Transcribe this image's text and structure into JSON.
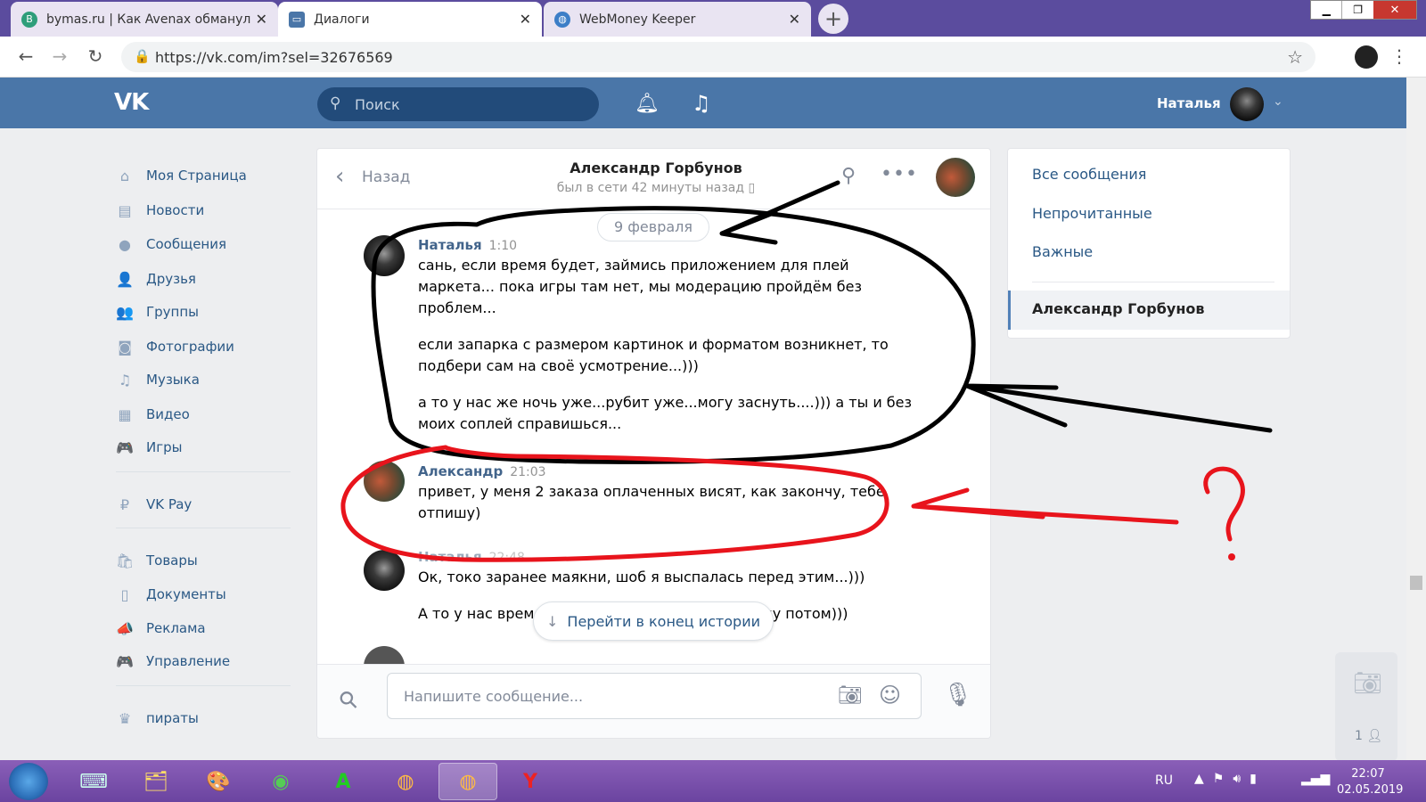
{
  "browser": {
    "tabs": [
      {
        "title": "bymas.ru | Как Avenax обманул",
        "icon_letter": "B"
      },
      {
        "title": "Диалоги",
        "active": true
      },
      {
        "title": "WebMoney Keeper"
      }
    ],
    "url": "https://vk.com/im?sel=32676569"
  },
  "header": {
    "search_placeholder": "Поиск",
    "user_name": "Наталья"
  },
  "sidebar": {
    "items": [
      {
        "label": "Моя Страница",
        "icon": "home-icon",
        "glyph": "⌂"
      },
      {
        "label": "Новости",
        "icon": "news-icon",
        "glyph": "▤"
      },
      {
        "label": "Сообщения",
        "icon": "messages-icon",
        "glyph": "●"
      },
      {
        "label": "Друзья",
        "icon": "friends-icon",
        "glyph": "👤"
      },
      {
        "label": "Группы",
        "icon": "groups-icon",
        "glyph": "👥"
      },
      {
        "label": "Фотографии",
        "icon": "photos-icon",
        "glyph": "◙"
      },
      {
        "label": "Музыка",
        "icon": "music-icon",
        "glyph": "♫"
      },
      {
        "label": "Видео",
        "icon": "video-icon",
        "glyph": "▦"
      },
      {
        "label": "Игры",
        "icon": "games-icon",
        "glyph": "🎮"
      }
    ],
    "items2": [
      {
        "label": "VK Pay",
        "icon": "vkpay-icon",
        "glyph": "₽"
      }
    ],
    "items3": [
      {
        "label": "Товары",
        "icon": "goods-icon",
        "glyph": "🛍"
      },
      {
        "label": "Документы",
        "icon": "docs-icon",
        "glyph": "▯"
      },
      {
        "label": "Реклама",
        "icon": "ads-icon",
        "glyph": "📣"
      },
      {
        "label": "Управление",
        "icon": "manage-icon",
        "glyph": "🎮"
      }
    ],
    "items4": [
      {
        "label": "пираты",
        "icon": "crown-icon",
        "glyph": "♛"
      }
    ]
  },
  "chat": {
    "back_label": "Назад",
    "contact_name": "Александр Горбунов",
    "contact_status": "был в сети 42 минуты назад",
    "date_sticky": "9 февраля",
    "messages": [
      {
        "author": "Наталья",
        "time": "1:10",
        "paragraphs": [
          "сань, если время будет, займись приложением для плей маркета... пока игры там нет, мы модерацию пройдём без проблем...",
          "если запарка с размером картинок и форматом возникнет, то подбери сам на своё усмотрение...)))",
          "а то у нас же ночь уже...рубит уже...могу заснуть....))) а ты и без моих соплей справишься..."
        ]
      },
      {
        "author": "Александр",
        "time": "21:03",
        "paragraphs": [
          "привет, у меня 2 заказа оплаченных висят, как закончу, тебе отпишу)"
        ]
      },
      {
        "author": "Наталья",
        "time": "22:48",
        "paragraphs": [
          "Ок, токо заранее маякни, шоб я выспалась перед этим...)))",
          "А то у нас время",
          "ку потом)))"
        ]
      }
    ],
    "jump_label": "Перейти в конец истории",
    "input_placeholder": "Напишите сообщение..."
  },
  "right_panel": {
    "items": [
      "Все сообщения",
      "Непрочитанные",
      "Важные"
    ],
    "selected": "Александр Горбунов"
  },
  "side_widget": {
    "count": "1"
  },
  "taskbar": {
    "lang": "RU",
    "time": "22:07",
    "date": "02.05.2019"
  },
  "colors": {
    "vk_blue": "#4a76a8",
    "link": "#2a5885",
    "annotation_black": "#000000",
    "annotation_red": "#e8141c"
  }
}
